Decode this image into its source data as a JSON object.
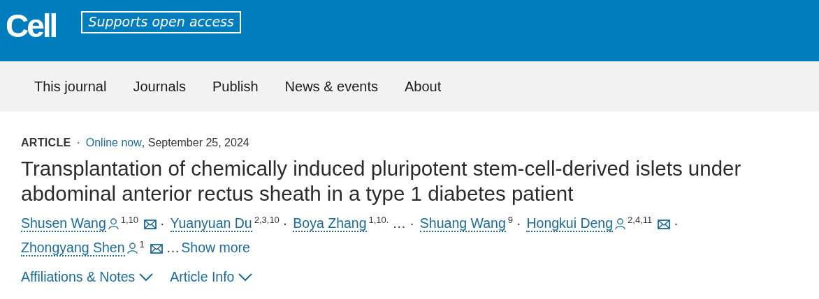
{
  "header": {
    "logo": "Cell",
    "badge": "Supports open access"
  },
  "nav": {
    "items": [
      "This journal",
      "Journals",
      "Publish",
      "News & events",
      "About"
    ]
  },
  "article": {
    "type": "ARTICLE",
    "separator": "·",
    "status": "Online now",
    "date": ", September 25, 2024",
    "title": "Transplantation of chemically induced pluripotent stem-cell-derived islets under abdominal anterior rectus sheath in a type 1 diabetes patient",
    "authors": [
      {
        "name": "Shusen Wang",
        "profile": true,
        "affiliations": "1,10",
        "email": true,
        "after": "·"
      },
      {
        "name": "Yuanyuan Du",
        "profile": false,
        "affiliations": "2,3,10",
        "email": false,
        "after": "·"
      },
      {
        "name": "Boya Zhang",
        "profile": false,
        "affiliations": "1,10.",
        "email": false,
        "after": "… ·"
      },
      {
        "name": "Shuang Wang",
        "profile": false,
        "affiliations": "9",
        "email": false,
        "after": "·"
      },
      {
        "name": "Hongkui Deng",
        "profile": true,
        "affiliations": "2,4,11",
        "email": true,
        "after": "·"
      },
      {
        "name": "Zhongyang Shen",
        "profile": true,
        "affiliations": "1",
        "email": true,
        "after": "…"
      }
    ],
    "show_more": "Show more",
    "toggles": [
      {
        "label": "Affiliations & Notes",
        "expanded": false
      },
      {
        "label": "Article Info",
        "expanded": false
      }
    ]
  }
}
